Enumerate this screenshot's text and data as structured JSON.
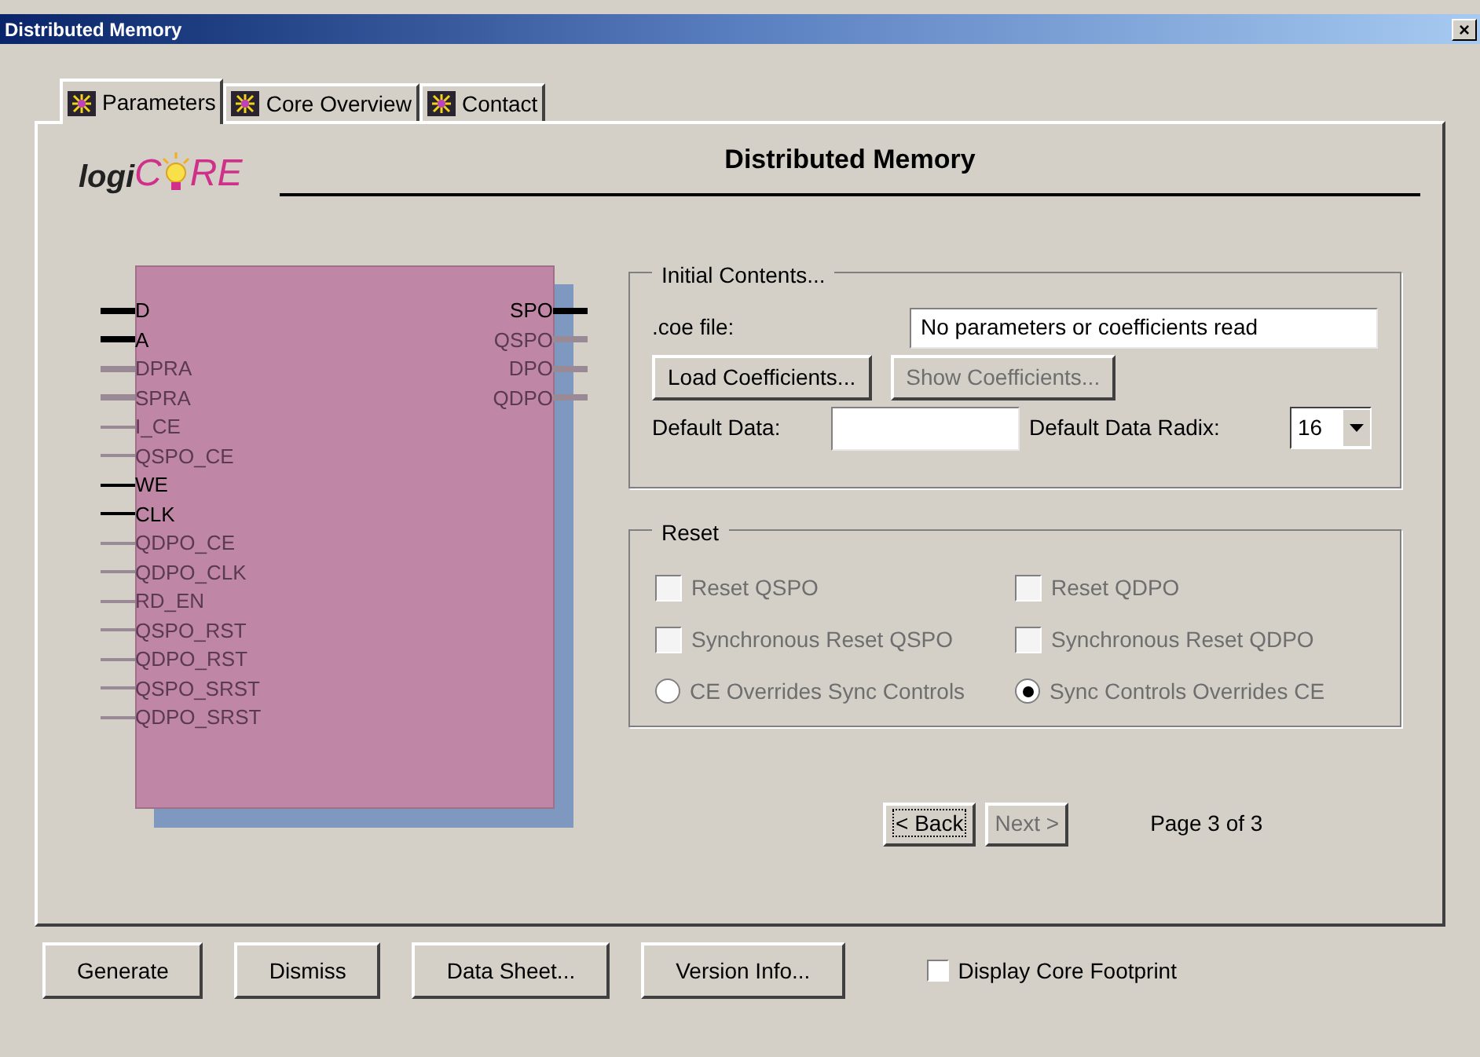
{
  "window": {
    "title": "Distributed Memory",
    "close": "×"
  },
  "tabs": [
    {
      "label": "Parameters",
      "selected": true
    },
    {
      "label": "Core Overview",
      "selected": false
    },
    {
      "label": "Contact",
      "selected": false
    }
  ],
  "logo": {
    "prefix": "logi",
    "c": "C",
    "rest": "RE"
  },
  "heading": "Distributed Memory",
  "inputs": [
    {
      "label": "D",
      "active": true,
      "bus": true
    },
    {
      "label": "A",
      "active": true,
      "bus": true
    },
    {
      "label": "DPRA",
      "active": false,
      "bus": true
    },
    {
      "label": "SPRA",
      "active": false,
      "bus": true
    },
    {
      "label": "I_CE",
      "active": false,
      "bus": false
    },
    {
      "label": "QSPO_CE",
      "active": false,
      "bus": false
    },
    {
      "label": "WE",
      "active": true,
      "bus": false
    },
    {
      "label": "CLK",
      "active": true,
      "bus": false
    },
    {
      "label": "QDPO_CE",
      "active": false,
      "bus": false
    },
    {
      "label": "QDPO_CLK",
      "active": false,
      "bus": false
    },
    {
      "label": "RD_EN",
      "active": false,
      "bus": false
    },
    {
      "label": "QSPO_RST",
      "active": false,
      "bus": false
    },
    {
      "label": "QDPO_RST",
      "active": false,
      "bus": false
    },
    {
      "label": "QSPO_SRST",
      "active": false,
      "bus": false
    },
    {
      "label": "QDPO_SRST",
      "active": false,
      "bus": false
    }
  ],
  "outputs": [
    {
      "label": "SPO",
      "active": true,
      "bus": true
    },
    {
      "label": "QSPO",
      "active": false,
      "bus": true
    },
    {
      "label": "DPO",
      "active": false,
      "bus": true
    },
    {
      "label": "QDPO",
      "active": false,
      "bus": true
    }
  ],
  "initial_contents": {
    "title": "Initial Contents...",
    "coe_label": ".coe file:",
    "coe_value": "No parameters or coefficients read",
    "buttons": [
      {
        "label": "Load Coefficients...",
        "disabled": false
      },
      {
        "label": "Show Coefficients...",
        "disabled": true
      }
    ],
    "default_data_label": "Default Data:",
    "radix_label": "Default Data Radix:",
    "radix_value": "16"
  },
  "reset": {
    "title": "Reset",
    "options": [
      {
        "kind": "checkbox",
        "label": "Reset QSPO",
        "checked": false,
        "disabled": true
      },
      {
        "kind": "checkbox",
        "label": "Reset QDPO",
        "checked": false,
        "disabled": true
      },
      {
        "kind": "checkbox",
        "label": "Synchronous Reset QSPO",
        "checked": false,
        "disabled": true
      },
      {
        "kind": "checkbox",
        "label": "Synchronous Reset QDPO",
        "checked": false,
        "disabled": true
      },
      {
        "kind": "radio",
        "label": "CE Overrides Sync Controls",
        "selected": false,
        "disabled": true
      },
      {
        "kind": "radio",
        "label": "Sync Controls Overrides CE",
        "selected": true,
        "disabled": true
      }
    ]
  },
  "nav": [
    {
      "label": "< Back",
      "disabled": false,
      "focused": true
    },
    {
      "label": "Next >",
      "disabled": true,
      "focused": false
    }
  ],
  "page_indicator": "Page 3 of 3",
  "footer_buttons": [
    "Generate",
    "Dismiss",
    "Data Sheet...",
    "Version Info..."
  ],
  "footprint": {
    "label": "Display Core Footprint",
    "checked": false
  }
}
